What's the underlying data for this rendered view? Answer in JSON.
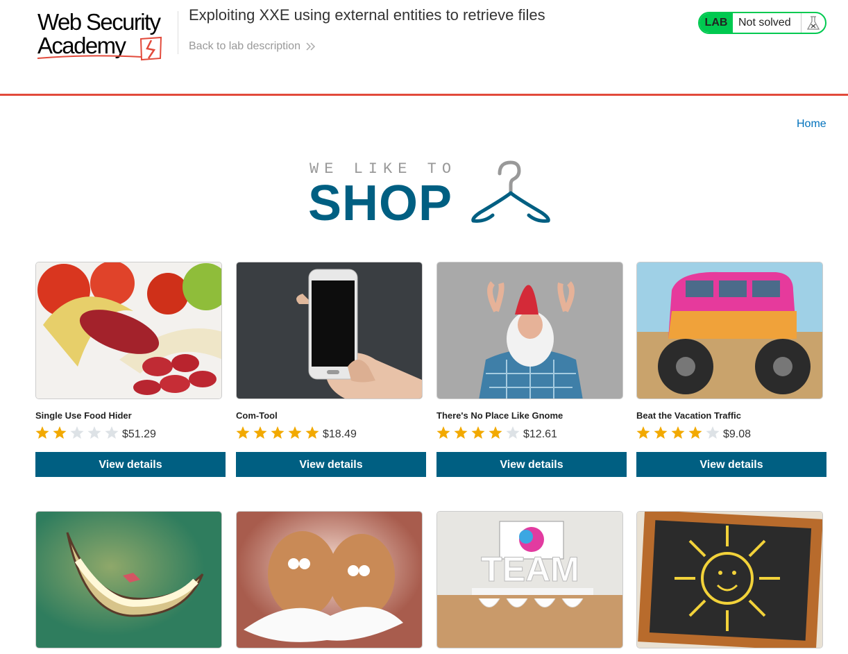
{
  "lab_header": {
    "logo": {
      "line1": "Web Security",
      "line2": "Academy"
    },
    "title": "Exploiting XXE using external entities to retrieve files",
    "back_link": "Back to lab description",
    "status_badge": {
      "tag": "LAB",
      "text": "Not solved",
      "color": "#00c950"
    }
  },
  "nav": {
    "home": "Home"
  },
  "banner": {
    "tagline": "WE LIKE TO",
    "title": "SHOP"
  },
  "colors": {
    "accent": "#005f82",
    "rule": "#e24a3b",
    "star_filled": "#f2a900",
    "star_empty": "#dde2e6",
    "link": "#0071bc"
  },
  "products": [
    {
      "name": "Single Use Food Hider",
      "rating": 2,
      "price": "$51.29",
      "button": "View details",
      "image": "food-hider-image"
    },
    {
      "name": "Com-Tool",
      "rating": 5,
      "price": "$18.49",
      "button": "View details",
      "image": "smartphone-image"
    },
    {
      "name": "There's No Place Like Gnome",
      "rating": 4,
      "price": "$12.61",
      "button": "View details",
      "image": "gnome-image"
    },
    {
      "name": "Beat the Vacation Traffic",
      "rating": 4,
      "price": "$9.08",
      "button": "View details",
      "image": "monster-van-image"
    },
    {
      "name": "",
      "image": "grin-image"
    },
    {
      "name": "",
      "image": "eggs-image"
    },
    {
      "name": "",
      "image": "team-image"
    },
    {
      "name": "",
      "image": "sun-chalkboard-image"
    }
  ]
}
